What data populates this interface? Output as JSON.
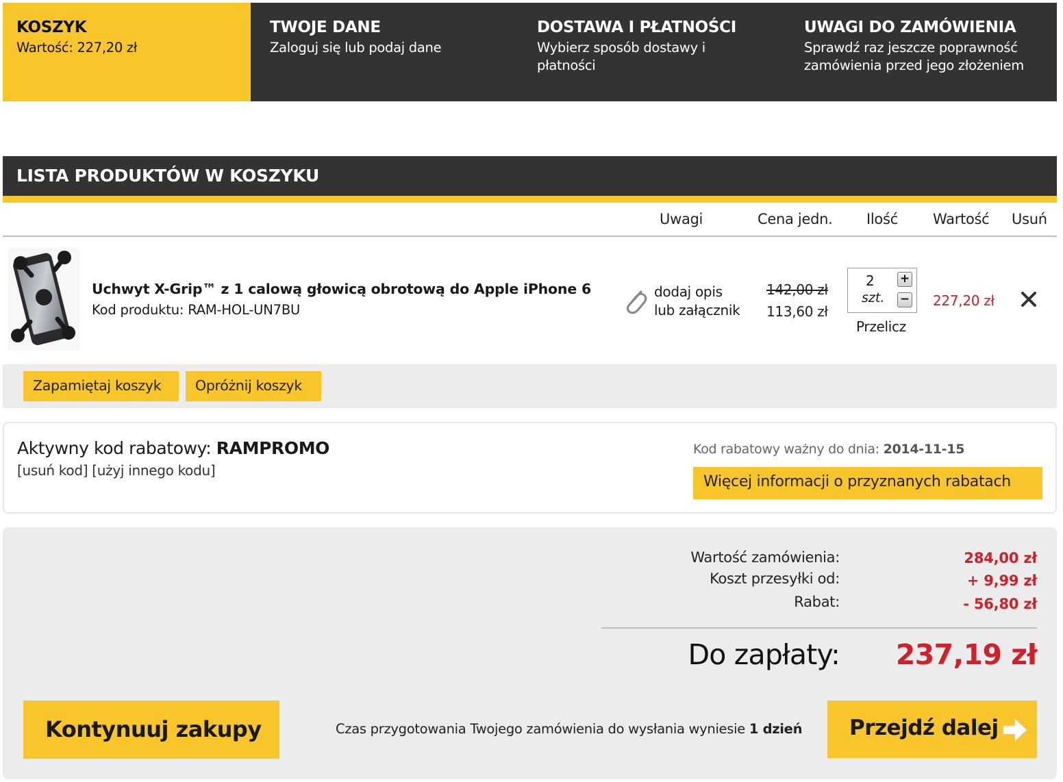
{
  "steps": [
    {
      "title": "KOSZYK",
      "desc": "Wartość: 227,20 zł",
      "active": true
    },
    {
      "title": "TWOJE DANE",
      "desc": "Zaloguj się lub podaj dane",
      "active": false
    },
    {
      "title": "DOSTAWA I PŁATNOŚCI",
      "desc_line1": "Wybierz sposób dostawy i",
      "desc_line2": "płatności",
      "active": false
    },
    {
      "title": "UWAGI DO ZAMÓWIENIA",
      "desc_line1": "Sprawdź raz jeszcze poprawność",
      "desc_line2": "zamówienia przed jego złożeniem",
      "active": false
    }
  ],
  "cart": {
    "title": "LISTA PRODUKTÓW W KOSZYKU",
    "columns": {
      "notes": "Uwagi",
      "unit_price": "Cena jedn.",
      "quantity": "Ilość",
      "value": "Wartość",
      "remove": "Usuń"
    },
    "items": [
      {
        "name": "Uchwyt X-Grip™ z 1 calową głowicą obrotową do Apple iPhone 6",
        "code": "Kod produktu: RAM-HOL-UN7BU",
        "note_line1": "dodaj opis",
        "note_line2": "lub załącznik",
        "price_old": "142,00 zł",
        "price_new": "113,60 zł",
        "quantity": "2",
        "unit": "szt.",
        "recalc": "Przelicz",
        "value": "227,20 zł"
      }
    ],
    "save_label": "Zapamiętaj koszyk",
    "empty_label": "Opróżnij koszyk"
  },
  "discount": {
    "label": "Aktywny kod rabatowy: ",
    "code": "RAMPROMO",
    "remove_link": "[usuń kod]",
    "other_link": "[użyj innego kodu]",
    "valid_label": "Kod rabatowy ważny do dnia: ",
    "valid_date": "2014-11-15",
    "more_label": "Więcej informacji o przyznanych rabatach"
  },
  "summary": {
    "order_value_label": "Wartość zamówienia:",
    "order_value": "284,00 zł",
    "shipping_label": "Koszt przesyłki od:",
    "shipping": "+ 9,99 zł",
    "discount_label": "Rabat:",
    "discount": "- 56,80 zł",
    "total_label": "Do zapłaty:",
    "total": "237,19 zł"
  },
  "footer": {
    "continue_label": "Kontynuuj zakupy",
    "prep_text": "Czas przygotowania Twojego zamówienia do wysłania wyniesie ",
    "prep_days": "1 dzień",
    "next_label": "Przejdź dalej"
  },
  "colors": {
    "accent": "#f8c52b",
    "dark": "#333333",
    "price_red": "#d0202a",
    "panel": "#ececec"
  }
}
